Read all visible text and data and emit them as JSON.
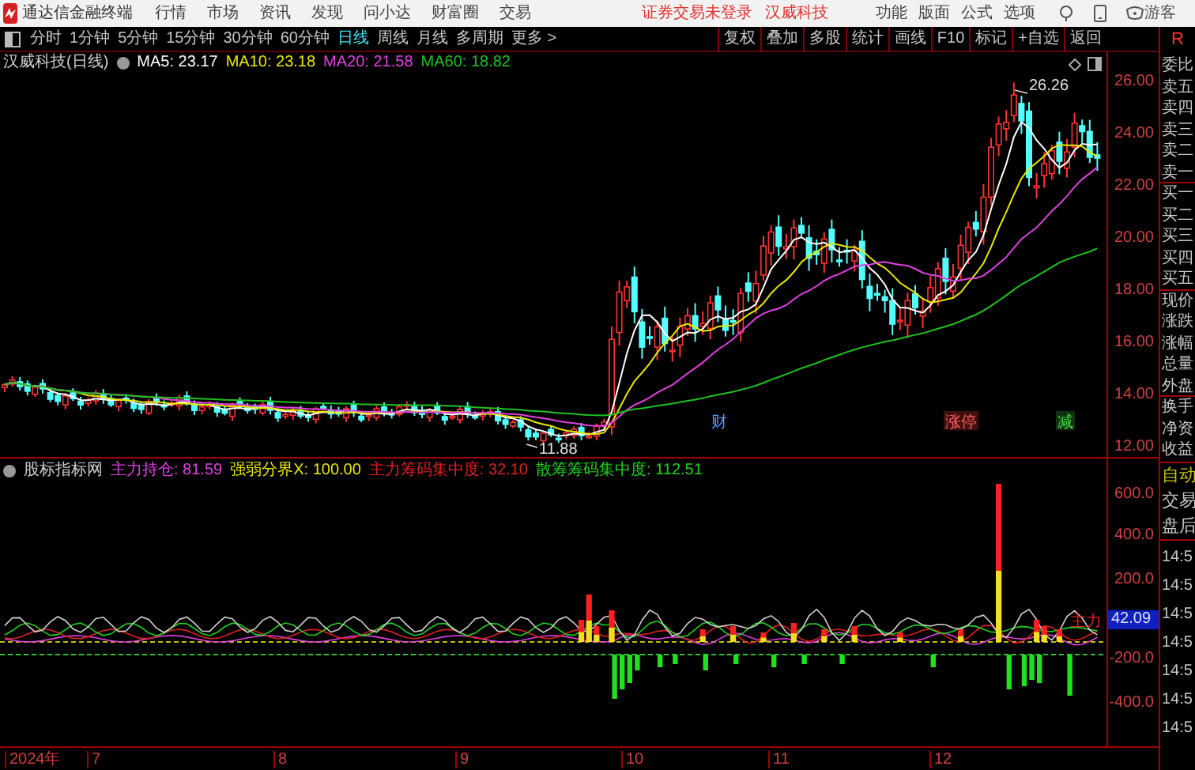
{
  "app": {
    "title": "通达信金融终端",
    "menu": [
      "行情",
      "市场",
      "资讯",
      "发现",
      "问小达",
      "财富圈",
      "交易"
    ],
    "notice": "证券交易未登录",
    "stock": "汉威科技",
    "tools": [
      "功能",
      "版面",
      "公式",
      "选项"
    ],
    "user": "游客"
  },
  "periods": [
    {
      "label": "分时",
      "selected": false
    },
    {
      "label": "1分钟",
      "selected": false
    },
    {
      "label": "5分钟",
      "selected": false
    },
    {
      "label": "15分钟",
      "selected": false
    },
    {
      "label": "30分钟",
      "selected": false
    },
    {
      "label": "60分钟",
      "selected": false
    },
    {
      "label": "日线",
      "selected": true
    },
    {
      "label": "周线",
      "selected": false
    },
    {
      "label": "月线",
      "selected": false
    },
    {
      "label": "多周期",
      "selected": false
    },
    {
      "label": "更多 >",
      "selected": false
    }
  ],
  "actions": [
    "复权",
    "叠加",
    "多股",
    "统计",
    "画线",
    "F10",
    "标记",
    "+自选",
    "返回"
  ],
  "side_header": "R",
  "main_pane": {
    "title": "汉威科技(日线)",
    "ma": [
      {
        "label": "MA5: 23.17",
        "color": "#ffffff"
      },
      {
        "label": "MA10: 23.18",
        "color": "#e8e800"
      },
      {
        "label": "MA20: 21.58",
        "color": "#e040e0"
      },
      {
        "label": "MA60: 18.82",
        "color": "#20c020"
      }
    ],
    "price_axis": [
      "26.00",
      "24.00",
      "22.00",
      "20.00",
      "18.00",
      "16.00",
      "14.00",
      "12.00"
    ],
    "annotations": [
      {
        "kind": "high",
        "text": "26.26"
      },
      {
        "kind": "low",
        "text": "11.88"
      },
      {
        "kind": "news",
        "text": "财"
      },
      {
        "kind": "limit",
        "text": "涨停"
      },
      {
        "kind": "reduce",
        "text": "减"
      }
    ]
  },
  "indicator_pane": {
    "title": "股标指标网",
    "items": [
      {
        "label": "主力持仓: 81.59",
        "color": "#e040e0"
      },
      {
        "label": "强弱分界X: 100.00",
        "color": "#e8e800"
      },
      {
        "label": "主力筹码集中度: 32.10",
        "color": "#e02020"
      },
      {
        "label": "散筹筹码集中度: 112.51",
        "color": "#20d020"
      }
    ],
    "axis": [
      "600.0",
      "400.0",
      "200.0",
      "-200.0",
      "-400.0"
    ],
    "current": "42.09",
    "line_label": "主力"
  },
  "quote_labels": [
    "委比",
    "卖五",
    "卖四",
    "卖三",
    "卖二",
    "卖一",
    "买一",
    "买二",
    "买三",
    "买四",
    "买五",
    "现价",
    "涨跌",
    "涨幅",
    "总量",
    "外盘",
    "换手",
    "净资",
    "收益"
  ],
  "modes": [
    {
      "label": "自动",
      "on": true
    },
    {
      "label": "交易",
      "on": false
    },
    {
      "label": "盘后",
      "on": false
    }
  ],
  "trade_times": [
    "14:5",
    "14:5",
    "14:5",
    "14:5",
    "14:5",
    "14:5",
    "14:5"
  ],
  "time_axis": [
    "2024年",
    "7",
    "8",
    "9",
    "10",
    "11",
    "12"
  ]
}
